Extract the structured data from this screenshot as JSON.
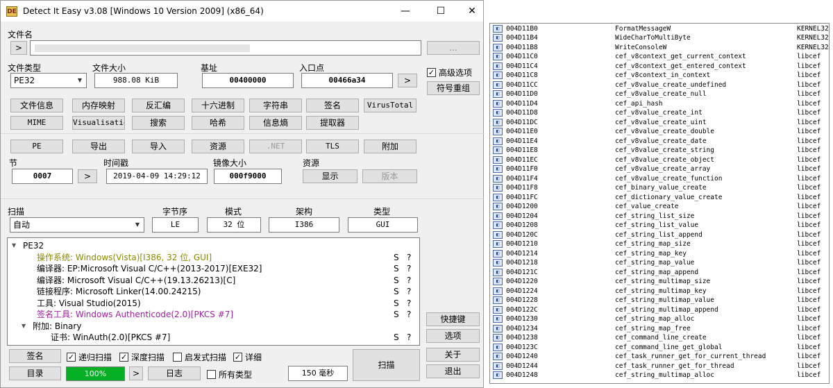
{
  "titlebar": {
    "title": "Detect It Easy v3.08 [Windows 10 Version 2009] (x86_64)",
    "min": "—",
    "max": "☐",
    "close": "✕",
    "icon_text": "DE"
  },
  "file": {
    "label": "文件名",
    "arrow": ">",
    "browse": "..."
  },
  "labels": {
    "filetype": "文件类型",
    "filesize": "文件大小",
    "base": "基址",
    "entry": "入口点",
    "section": "节",
    "timestamp": "时间戳",
    "imagesize": "镜像大小",
    "resource": "资源",
    "scan": "扫描",
    "endian": "字节序",
    "mode": "模式",
    "arch": "架构",
    "type": "类型"
  },
  "values": {
    "filetype": "PE32",
    "filesize": "988.08 KiB",
    "base": "00400000",
    "entry": "00466a34",
    "section": "0007",
    "timestamp": "2019-04-09 14:29:12",
    "imagesize": "000f9000",
    "scan": "自动",
    "endian": "LE",
    "mode": "32 位",
    "arch": "I386",
    "type": "GUI"
  },
  "options": {
    "advanced": "高级选项",
    "symbol_reorg": "符号重组",
    "advanced_checked": true
  },
  "buttons_row1": [
    "文件信息",
    "内存映射",
    "反汇编",
    "十六进制",
    "字符串",
    "签名",
    "VirusTotal"
  ],
  "buttons_row2": [
    "MIME",
    "Visualisation",
    "搜索",
    "哈希",
    "信息熵",
    "提取器"
  ],
  "buttons_row3": [
    "PE",
    "导出",
    "导入",
    "资源",
    ".NET",
    "TLS",
    "附加"
  ],
  "arrow": ">",
  "resource_buttons": {
    "show": "显示",
    "version": "版本"
  },
  "tree": [
    {
      "text": "PE32",
      "level": 0,
      "toggle": "▼",
      "color": "#000000",
      "s": "",
      "q": ""
    },
    {
      "text": "操作系统: Windows(Vista)[I386, 32 位, GUI]",
      "level": 2,
      "color": "#8a8a00",
      "s": "S",
      "q": "?"
    },
    {
      "text": "编译器: EP:Microsoft Visual C/C++(2013-2017)[EXE32]",
      "level": 2,
      "color": "#000000",
      "s": "S",
      "q": "?"
    },
    {
      "text": "编译器: Microsoft Visual C/C++(19.13.26213)[C]",
      "level": 2,
      "color": "#000000",
      "s": "S",
      "q": "?"
    },
    {
      "text": "链接程序: Microsoft Linker(14.00.24215)",
      "level": 2,
      "color": "#000000",
      "s": "S",
      "q": "?"
    },
    {
      "text": "工具: Visual Studio(2015)",
      "level": 2,
      "color": "#000000",
      "s": "S",
      "q": "?"
    },
    {
      "text": "签名工具: Windows Authenticode(2.0)[PKCS #7]",
      "level": 2,
      "color": "#a020a0",
      "s": "S",
      "q": "?"
    },
    {
      "text": "附加: Binary",
      "level": 1,
      "toggle": "▼",
      "color": "#000000",
      "s": "",
      "q": ""
    },
    {
      "text": "证书: WinAuth(2.0)[PKCS #7]",
      "level": 3,
      "color": "#000000",
      "s": "S",
      "q": "?"
    }
  ],
  "side_buttons": {
    "shortcuts": "快捷键",
    "options": "选项",
    "about": "关于",
    "exit": "退出"
  },
  "bottom": {
    "signature": "签名",
    "recursive": "递归扫描",
    "deep": "深度扫描",
    "heuristic": "启发式扫描",
    "verbose": "详细",
    "scan_button": "扫描",
    "directory": "目录",
    "progress": "100%",
    "log": "日志",
    "all_types": "所有类型",
    "time": "150 毫秒"
  },
  "bottom_checks": {
    "recursive": true,
    "deep": true,
    "heuristic": false,
    "verbose": true,
    "all_types": false
  },
  "imports": [
    {
      "addr": "004D11B0",
      "func": "FormatMessageW",
      "lib": "KERNEL32"
    },
    {
      "addr": "004D11B4",
      "func": "WideCharToMultiByte",
      "lib": "KERNEL32"
    },
    {
      "addr": "004D11B8",
      "func": "WriteConsoleW",
      "lib": "KERNEL32"
    },
    {
      "addr": "004D11C0",
      "func": "cef_v8context_get_current_context",
      "lib": "libcef"
    },
    {
      "addr": "004D11C4",
      "func": "cef_v8context_get_entered_context",
      "lib": "libcef"
    },
    {
      "addr": "004D11C8",
      "func": "cef_v8context_in_context",
      "lib": "libcef"
    },
    {
      "addr": "004D11CC",
      "func": "cef_v8value_create_undefined",
      "lib": "libcef"
    },
    {
      "addr": "004D11D0",
      "func": "cef_v8value_create_null",
      "lib": "libcef"
    },
    {
      "addr": "004D11D4",
      "func": "cef_api_hash",
      "lib": "libcef"
    },
    {
      "addr": "004D11D8",
      "func": "cef_v8value_create_int",
      "lib": "libcef"
    },
    {
      "addr": "004D11DC",
      "func": "cef_v8value_create_uint",
      "lib": "libcef"
    },
    {
      "addr": "004D11E0",
      "func": "cef_v8value_create_double",
      "lib": "libcef"
    },
    {
      "addr": "004D11E4",
      "func": "cef_v8value_create_date",
      "lib": "libcef"
    },
    {
      "addr": "004D11E8",
      "func": "cef_v8value_create_string",
      "lib": "libcef"
    },
    {
      "addr": "004D11EC",
      "func": "cef_v8value_create_object",
      "lib": "libcef"
    },
    {
      "addr": "004D11F0",
      "func": "cef_v8value_create_array",
      "lib": "libcef"
    },
    {
      "addr": "004D11F4",
      "func": "cef_v8value_create_function",
      "lib": "libcef"
    },
    {
      "addr": "004D11F8",
      "func": "cef_binary_value_create",
      "lib": "libcef"
    },
    {
      "addr": "004D11FC",
      "func": "cef_dictionary_value_create",
      "lib": "libcef"
    },
    {
      "addr": "004D1200",
      "func": "cef_value_create",
      "lib": "libcef"
    },
    {
      "addr": "004D1204",
      "func": "cef_string_list_size",
      "lib": "libcef"
    },
    {
      "addr": "004D1208",
      "func": "cef_string_list_value",
      "lib": "libcef"
    },
    {
      "addr": "004D120C",
      "func": "cef_string_list_append",
      "lib": "libcef"
    },
    {
      "addr": "004D1210",
      "func": "cef_string_map_size",
      "lib": "libcef"
    },
    {
      "addr": "004D1214",
      "func": "cef_string_map_key",
      "lib": "libcef"
    },
    {
      "addr": "004D1218",
      "func": "cef_string_map_value",
      "lib": "libcef"
    },
    {
      "addr": "004D121C",
      "func": "cef_string_map_append",
      "lib": "libcef"
    },
    {
      "addr": "004D1220",
      "func": "cef_string_multimap_size",
      "lib": "libcef"
    },
    {
      "addr": "004D1224",
      "func": "cef_string_multimap_key",
      "lib": "libcef"
    },
    {
      "addr": "004D1228",
      "func": "cef_string_multimap_value",
      "lib": "libcef"
    },
    {
      "addr": "004D122C",
      "func": "cef_string_multimap_append",
      "lib": "libcef"
    },
    {
      "addr": "004D1230",
      "func": "cef_string_map_alloc",
      "lib": "libcef"
    },
    {
      "addr": "004D1234",
      "func": "cef_string_map_free",
      "lib": "libcef"
    },
    {
      "addr": "004D1238",
      "func": "cef_command_line_create",
      "lib": "libcef"
    },
    {
      "addr": "004D123C",
      "func": "cef_command_line_get_global",
      "lib": "libcef"
    },
    {
      "addr": "004D1240",
      "func": "cef_task_runner_get_for_current_thread",
      "lib": "libcef"
    },
    {
      "addr": "004D1244",
      "func": "cef_task_runner_get_for_thread",
      "lib": "libcef"
    },
    {
      "addr": "004D1248",
      "func": "cef_string_multimap_alloc",
      "lib": "libcef"
    }
  ]
}
